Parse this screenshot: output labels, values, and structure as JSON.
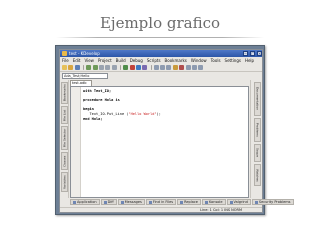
{
  "slide": {
    "title": "Ejemplo grafico"
  },
  "window": {
    "title": "test - KDevelop"
  },
  "menubar": {
    "items": [
      "File",
      "Edit",
      "View",
      "Project",
      "Build",
      "Debug",
      "Scripts",
      "Bookmarks",
      "Window",
      "Tools",
      "Settings",
      "Help"
    ]
  },
  "toolbar": {
    "function_combo": "Ada_Test;Hello"
  },
  "left_dock": {
    "tabs": [
      "Bookmarks",
      "File List",
      "File Selector",
      "Classes",
      "Variables"
    ]
  },
  "editor": {
    "file_tab": "test.adb",
    "lines": [
      "with Text_IO;",
      "",
      "procedure Hola is",
      "",
      "begin",
      "   Text_IO.Put_Line (\"Hello World\");",
      "end Hola;"
    ]
  },
  "right_dock": {
    "tabs": [
      "Documentation",
      "Problems",
      "Scope",
      "Watches"
    ]
  },
  "bottom_tabs": [
    "Application",
    "Diff",
    "Messages",
    "Find in Files",
    "Replace",
    "Konsole",
    "Valgrind",
    "Security Problems"
  ],
  "status": {
    "text": "Line: 1 Col: 1  INS  NORM"
  }
}
